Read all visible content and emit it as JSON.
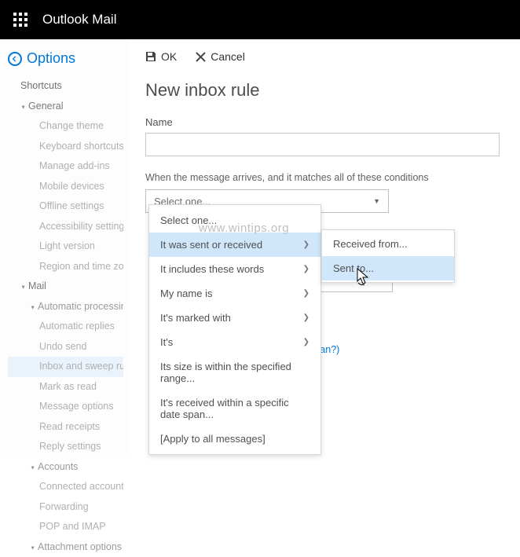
{
  "app": {
    "name": "Outlook Mail"
  },
  "sidebar": {
    "header": "Options",
    "items": [
      {
        "label": "Shortcuts",
        "lvl": 0
      },
      {
        "label": "General",
        "lvl": 1,
        "caret": true
      },
      {
        "label": "Change theme",
        "lvl": 3
      },
      {
        "label": "Keyboard shortcuts",
        "lvl": 3
      },
      {
        "label": "Manage add-ins",
        "lvl": 3
      },
      {
        "label": "Mobile devices",
        "lvl": 3
      },
      {
        "label": "Offline settings",
        "lvl": 3
      },
      {
        "label": "Accessibility settings",
        "lvl": 3
      },
      {
        "label": "Light version",
        "lvl": 3
      },
      {
        "label": "Region and time zone",
        "lvl": 3
      },
      {
        "label": "Mail",
        "lvl": 1,
        "caret": true
      },
      {
        "label": "Automatic processing",
        "lvl": 2,
        "caret": true
      },
      {
        "label": "Automatic replies",
        "lvl": 3
      },
      {
        "label": "Undo send",
        "lvl": 3
      },
      {
        "label": "Inbox and sweep rules",
        "lvl": 3,
        "selected": true
      },
      {
        "label": "Mark as read",
        "lvl": 3
      },
      {
        "label": "Message options",
        "lvl": 3
      },
      {
        "label": "Read receipts",
        "lvl": 3
      },
      {
        "label": "Reply settings",
        "lvl": 3
      },
      {
        "label": "Accounts",
        "lvl": 2,
        "caret": true
      },
      {
        "label": "Connected accounts",
        "lvl": 3
      },
      {
        "label": "Forwarding",
        "lvl": 3
      },
      {
        "label": "POP and IMAP",
        "lvl": 3
      },
      {
        "label": "Attachment options",
        "lvl": 2,
        "caret": true
      }
    ]
  },
  "content": {
    "ok": "OK",
    "cancel": "Cancel",
    "title": "New inbox rule",
    "name_label": "Name",
    "name_value": "",
    "cond_label": "When the message arrives, and it matches all of these conditions",
    "select_placeholder": "Select one...",
    "mean_link": "this mean?)"
  },
  "menu1": [
    {
      "label": "Select one...",
      "sub": false
    },
    {
      "label": "It was sent or received",
      "sub": true,
      "hov": true
    },
    {
      "label": "It includes these words",
      "sub": true
    },
    {
      "label": "My name is",
      "sub": true
    },
    {
      "label": "It's marked with",
      "sub": true
    },
    {
      "label": "It's",
      "sub": true
    },
    {
      "label": "Its size is within the specified range...",
      "sub": false
    },
    {
      "label": "It's received within a specific date span...",
      "sub": false
    },
    {
      "label": "[Apply to all messages]",
      "sub": false
    }
  ],
  "menu2": [
    {
      "label": "Received from..."
    },
    {
      "label": "Sent to...",
      "hov": true
    }
  ],
  "watermark": "www.wintips.org"
}
